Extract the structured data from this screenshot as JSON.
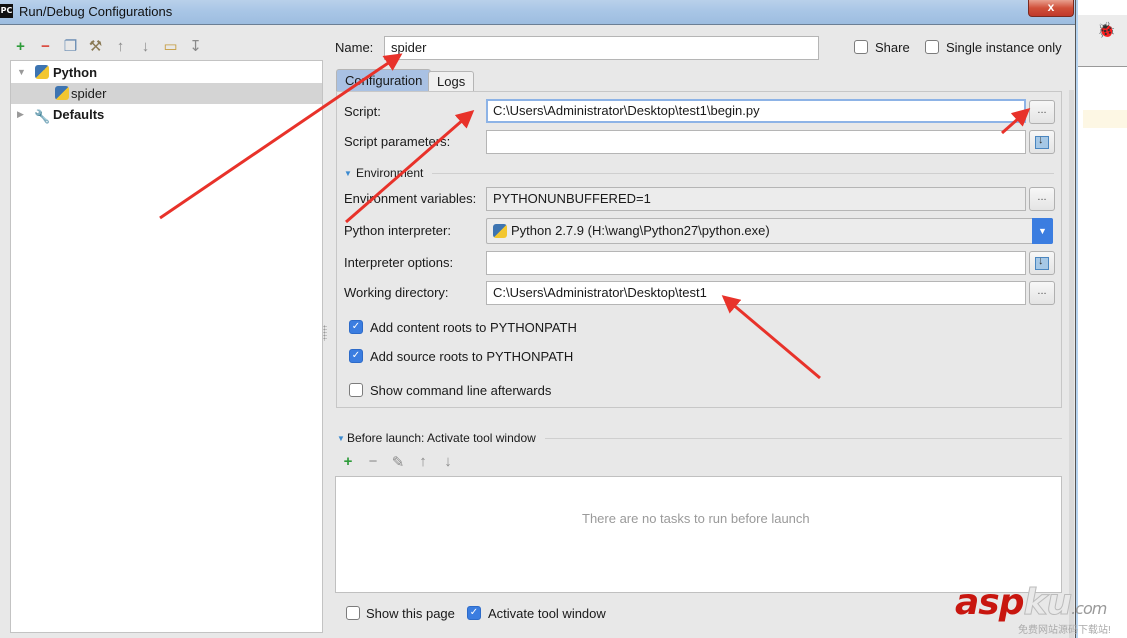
{
  "window": {
    "app_icon": "PC",
    "title": "Run/Debug Configurations",
    "close_label": "x"
  },
  "left_toolbar": {
    "icons": [
      "add-icon",
      "remove-icon",
      "copy-icon",
      "edit-defaults-icon",
      "move-up-icon",
      "move-down-icon",
      "folder-icon",
      "sort-icon"
    ],
    "glyphs": [
      "+",
      "−",
      "❐",
      "⚒",
      "↑",
      "↓",
      "▭",
      "↧"
    ]
  },
  "tree": {
    "items": [
      {
        "label": "Python",
        "expanded": true,
        "bold": true
      },
      {
        "label": "spider",
        "selected": true
      },
      {
        "label": "Defaults",
        "expanded": false,
        "bold": true
      }
    ]
  },
  "header": {
    "name_label": "Name:",
    "name_value": "spider",
    "share_label": "Share",
    "share_checked": false,
    "single_instance_label": "Single instance only",
    "single_instance_checked": false
  },
  "tabs": [
    {
      "label": "Configuration",
      "active": true
    },
    {
      "label": "Logs",
      "active": false
    }
  ],
  "config": {
    "script_label": "Script:",
    "script_value": "C:\\Users\\Administrator\\Desktop\\test1\\begin.py",
    "script_params_label": "Script parameters:",
    "script_params_value": "",
    "environment_section": "Environment",
    "env_vars_label": "Environment variables:",
    "env_vars_value": "PYTHONUNBUFFERED=1",
    "interpreter_label": "Python interpreter:",
    "interpreter_value": "Python 2.7.9 (H:\\wang\\Python27\\python.exe)",
    "interp_options_label": "Interpreter options:",
    "interp_options_value": "",
    "working_dir_label": "Working directory:",
    "working_dir_value": "C:\\Users\\Administrator\\Desktop\\test1",
    "browse_label": "...",
    "add_content_roots_label": "Add content roots to PYTHONPATH",
    "add_content_roots_checked": true,
    "add_source_roots_label": "Add source roots to PYTHONPATH",
    "add_source_roots_checked": true,
    "show_cmd_label": "Show command line afterwards",
    "show_cmd_checked": false
  },
  "before_launch": {
    "title": "Before launch: Activate tool window",
    "toolbar_glyphs": [
      "+",
      "−",
      "✎",
      "↑",
      "↓"
    ],
    "empty_text": "There are no tasks to run before launch",
    "show_page_label": "Show this page",
    "show_page_checked": false,
    "activate_tool_label": "Activate tool window",
    "activate_tool_checked": true
  },
  "watermark": {
    "brand_red": "asp",
    "brand_white": "ku",
    "brand_suffix": ".com",
    "subtitle": "免费网站源码下载站!"
  },
  "colors": {
    "accent_blue": "#3b7de0",
    "annotation_red": "#e8322a",
    "tab_active": "#a9c1e3"
  }
}
